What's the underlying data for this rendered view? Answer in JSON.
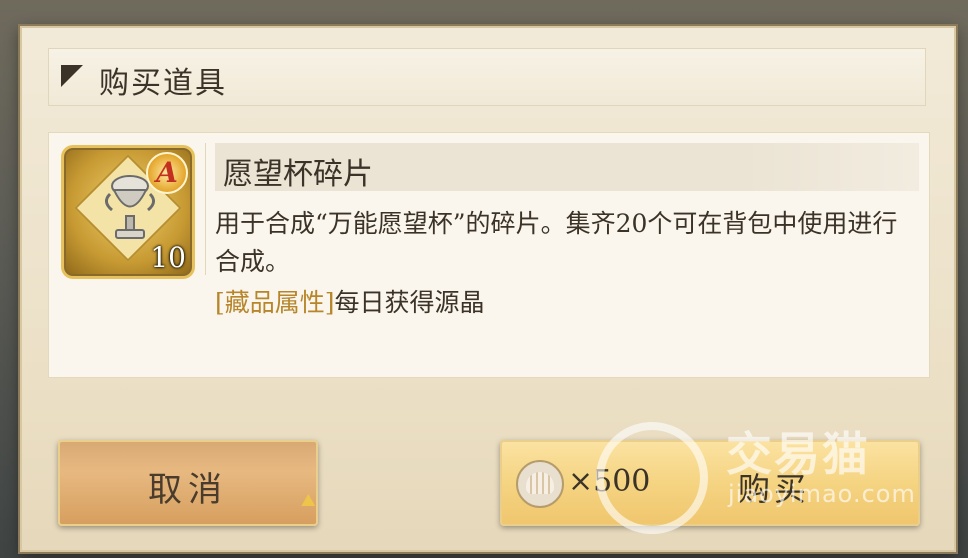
{
  "dialog": {
    "title": "购买道具"
  },
  "item": {
    "name": "愿望杯碎片",
    "grade": "A",
    "count": "10",
    "description": "用于合成“万能愿望杯”的碎片。集齐20个可在背包中使用进行合成。",
    "attribute_tag": "[藏品属性]",
    "attribute_value": "每日获得源晶"
  },
  "buttons": {
    "cancel_label": "取消",
    "buy_label": "购买",
    "price": "×500",
    "currency_icon": "shell-icon"
  },
  "watermark": {
    "brand": "交易猫",
    "url": "jiaoyimao.com"
  }
}
